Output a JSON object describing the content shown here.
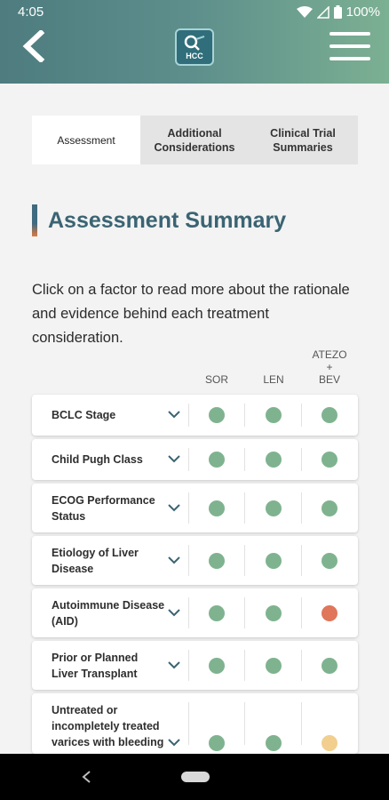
{
  "status": {
    "time": "4:05",
    "battery": "100%"
  },
  "tabs": [
    {
      "label": "Assessment",
      "active": true
    },
    {
      "label": "Additional Considerations",
      "active": false
    },
    {
      "label": "Clinical Trial Summaries",
      "active": false
    }
  ],
  "section_title": "Assessment Summary",
  "intro": "Click on a factor to read more about the rationale and evidence behind each treatment consideration.",
  "columns": [
    "SOR",
    "LEN",
    "ATEZO + BEV"
  ],
  "status_colors": {
    "green": "#7fb38f",
    "red": "#e0765a",
    "yellow": "#f2cf8e"
  },
  "factors": [
    {
      "label": "BCLC Stage",
      "status": [
        "green",
        "green",
        "green"
      ]
    },
    {
      "label": "Child Pugh Class",
      "status": [
        "green",
        "green",
        "green"
      ]
    },
    {
      "label": "ECOG Performance Status",
      "status": [
        "green",
        "green",
        "green"
      ]
    },
    {
      "label": "Etiology of Liver Disease",
      "status": [
        "green",
        "green",
        "green"
      ]
    },
    {
      "label": "Autoimmune Disease (AID)",
      "status": [
        "green",
        "green",
        "red"
      ]
    },
    {
      "label": "Prior or Planned Liver Transplant",
      "status": [
        "green",
        "green",
        "green"
      ]
    },
    {
      "label": "Untreated or incompletely treated varices with bleeding",
      "status": [
        "green",
        "green",
        "yellow"
      ]
    }
  ]
}
